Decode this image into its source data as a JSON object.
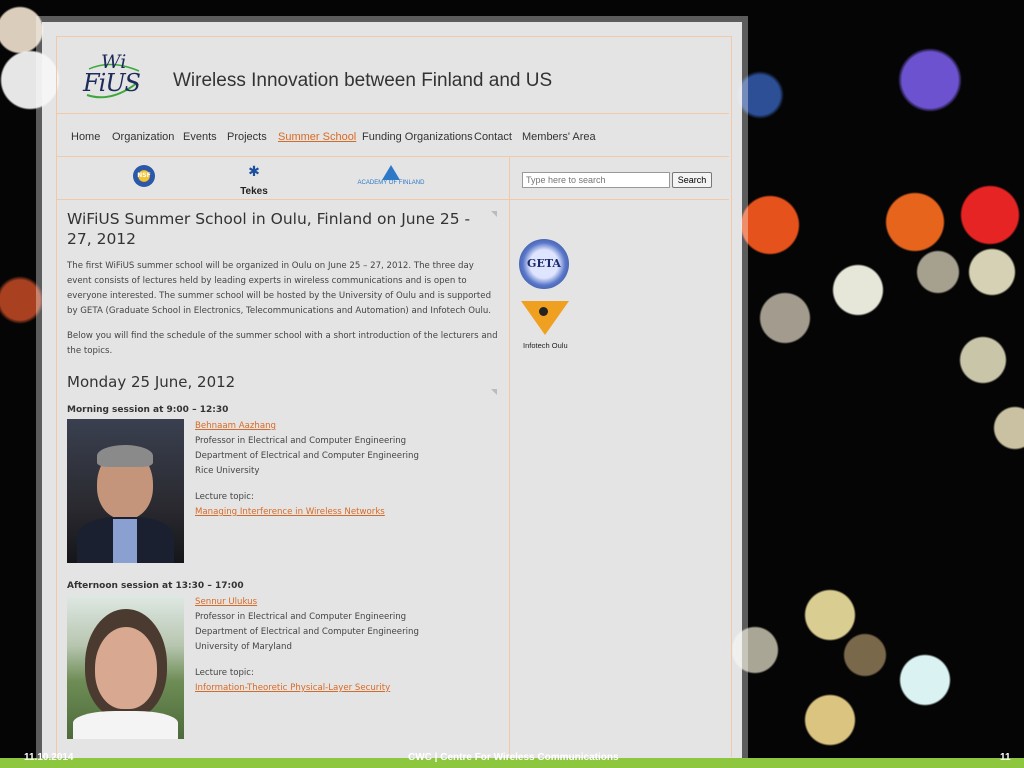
{
  "header": {
    "logo_wi": "Wi",
    "logo_fius": "FiUS",
    "title": "Wireless Innovation between Finland and US"
  },
  "nav": {
    "items": [
      {
        "label": "Home"
      },
      {
        "label": "Organization"
      },
      {
        "label": "Events"
      },
      {
        "label": "Projects"
      },
      {
        "label": "Summer School",
        "active": true
      },
      {
        "label": "Funding Organizations"
      },
      {
        "label": "Contact"
      },
      {
        "label": "Members' Area"
      }
    ]
  },
  "sponsors": {
    "nsf": "NSF",
    "tekes": "Tekes",
    "aof": "ACADEMY OF FINLAND"
  },
  "search": {
    "placeholder": "Type here to search",
    "button": "Search"
  },
  "sidebar": {
    "geta": "GETA",
    "infotech": "Infotech Oulu"
  },
  "content": {
    "title": "WiFiUS Summer School in Oulu, Finland on June 25 - 27, 2012",
    "intro": "The first WiFiUS summer school will be organized in Oulu on June 25 – 27, 2012. The three day event consists of lectures held by leading experts in wireless communications and is open to everyone interested. The summer school will be hosted by the University of Oulu and is supported by GETA (Graduate School in Electronics, Telecommunications and Automation) and Infotech Oulu.",
    "below": "Below you will find the schedule of the summer school with a short introduction of the lecturers and the topics.",
    "day": "Monday 25 June, 2012",
    "sessions": [
      {
        "title": "Morning session at 9:00 – 12:30",
        "name": "Behnaam Aazhang",
        "role": "Professor in Electrical and Computer Engineering",
        "dept": "Department of Electrical and Computer Engineering",
        "univ": "Rice University",
        "topic_label": "Lecture topic:",
        "topic": "Managing Interference in Wireless Networks"
      },
      {
        "title": "Afternoon session at 13:30 – 17:00",
        "name": "Sennur Ulukus",
        "role": "Professor in Electrical and Computer Engineering",
        "dept": "Department of Electrical and Computer Engineering",
        "univ": "University of Maryland",
        "topic_label": "Lecture topic:",
        "topic": "Information-Theoretic Physical-Layer Security"
      }
    ]
  },
  "footer": {
    "date": "11.10.2014",
    "center": "CWC | Centre For Wireless Communications",
    "page": "11"
  }
}
